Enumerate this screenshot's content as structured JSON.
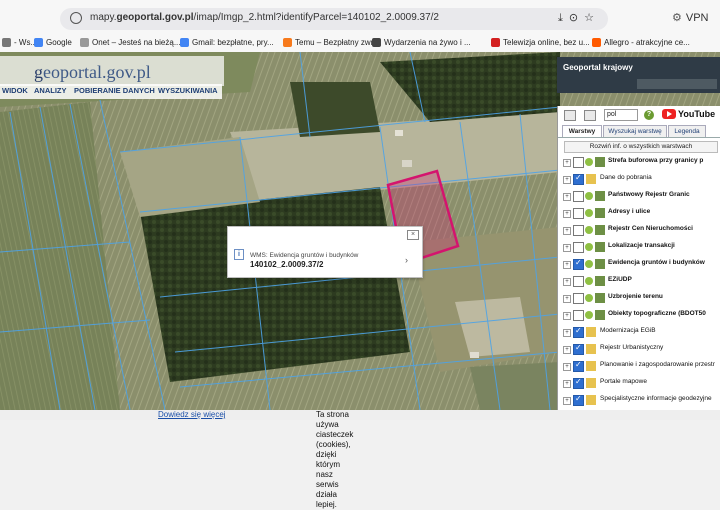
{
  "browser": {
    "url_prefix": "mapy.",
    "url_domain": "geoportal.gov.pl",
    "url_path": "/imap/Imgp_2.html?identifyParcel=140102_2.0009.37/2",
    "vpn_label": "VPN"
  },
  "bookmarks": [
    {
      "label": "- Ws...",
      "icon": "page-icon",
      "color": "#777777"
    },
    {
      "label": "Google",
      "icon": "google-icon",
      "color": "#4285f4"
    },
    {
      "label": "Onet – Jesteś na bieżą...",
      "icon": "onet-icon",
      "color": "#999999"
    },
    {
      "label": "Gmail: bezpłatne, pry...",
      "icon": "google-icon",
      "color": "#4285f4"
    },
    {
      "label": "Temu – Bezpłatny zwr...",
      "icon": "temu-icon",
      "color": "#f77a1c"
    },
    {
      "label": "Wydarzenia na żywo i ...",
      "icon": "news-icon",
      "color": "#444444"
    },
    {
      "label": "Telewizja online, bez u...",
      "icon": "tv-icon",
      "color": "#d32020"
    },
    {
      "label": "Allegro - atrakcyjne ce...",
      "icon": "allegro-icon",
      "color": "#ff5a00"
    }
  ],
  "site": {
    "logo_prefix": "g",
    "logo_rest": "eoportal.gov.pl",
    "menu": [
      "WIDOK",
      "ANALIZY",
      "POBIERANIE DANYCH",
      "WYSZUKIWANIA"
    ]
  },
  "popup": {
    "title": "WMS: Ewidencja gruntów i budynków",
    "parcel_id": "140102_2.0009.37/2"
  },
  "panel": {
    "header_title": "Geoportal krajowy",
    "language": "pol",
    "youtube_label": "YouTube",
    "tabs": [
      "Warstwy",
      "Wyszukaj warstwę",
      "Legenda"
    ],
    "expand_all": "Rozwiń inf. o wszystkich warstwach",
    "layers": [
      {
        "label": "Strefa buforowa przy granicy p",
        "checked": false,
        "bold": true,
        "dot": true,
        "kind": "layer"
      },
      {
        "label": "Dane do pobrania",
        "checked": true,
        "bold": false,
        "dot": false,
        "kind": "folder"
      },
      {
        "label": "Państwowy Rejestr Granic",
        "checked": false,
        "bold": true,
        "dot": true,
        "kind": "layer"
      },
      {
        "label": "Adresy i ulice",
        "checked": false,
        "bold": true,
        "dot": true,
        "kind": "layer"
      },
      {
        "label": "Rejestr Cen Nieruchomości",
        "checked": false,
        "bold": true,
        "dot": true,
        "kind": "layer"
      },
      {
        "label": "Lokalizacje transakcji",
        "checked": false,
        "bold": true,
        "dot": true,
        "kind": "layer"
      },
      {
        "label": "Ewidencja gruntów i budynków",
        "checked": true,
        "bold": true,
        "dot": true,
        "kind": "layer"
      },
      {
        "label": "EZiUDP",
        "checked": false,
        "bold": true,
        "dot": true,
        "kind": "layer"
      },
      {
        "label": "Uzbrojenie terenu",
        "checked": false,
        "bold": true,
        "dot": true,
        "kind": "layer"
      },
      {
        "label": "Obiekty topograficzne (BDOT50",
        "checked": false,
        "bold": true,
        "dot": true,
        "kind": "layer"
      },
      {
        "label": "Modernizacja EGiB",
        "checked": true,
        "bold": false,
        "dot": false,
        "kind": "folder"
      },
      {
        "label": "Rejestr Urbanistyczny",
        "checked": true,
        "bold": false,
        "dot": false,
        "kind": "folder"
      },
      {
        "label": "Planowanie i zagospodarowanie przestr",
        "checked": true,
        "bold": false,
        "dot": false,
        "kind": "folder"
      },
      {
        "label": "Portale mapowe",
        "checked": true,
        "bold": false,
        "dot": false,
        "kind": "folder"
      },
      {
        "label": "Specjalistyczne informacje geodezyjne",
        "checked": true,
        "bold": false,
        "dot": false,
        "kind": "folder"
      }
    ]
  },
  "cookie": {
    "text": "Ta strona używa ciasteczek (cookies), dzięki którym nasz serwis działa lepiej. ",
    "link": "Dowiedz się więcej"
  },
  "colors": {
    "parcel_outline": "#d4146e",
    "parcel_lines": "#4da3e8",
    "link": "#1a4fa8"
  }
}
